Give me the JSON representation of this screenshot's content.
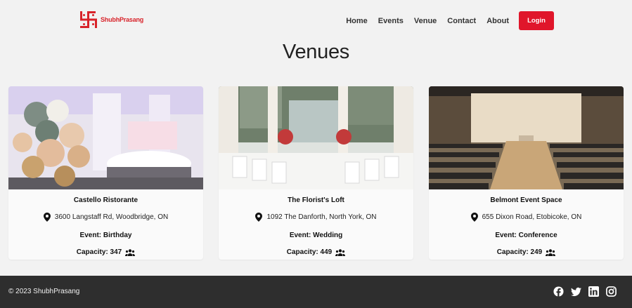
{
  "brand": {
    "name": "ShubhPrasang",
    "color": "#d8232a"
  },
  "nav": {
    "items": [
      {
        "label": "Home"
      },
      {
        "label": "Events"
      },
      {
        "label": "Venue"
      },
      {
        "label": "Contact"
      },
      {
        "label": "About"
      }
    ],
    "login_label": "Login"
  },
  "page": {
    "title": "Venues"
  },
  "venues": [
    {
      "name": "Castello Ristorante",
      "address": "3600 Langstaff Rd, Woodbridge, ON",
      "event": "Event: Birthday",
      "capacity": "Capacity: 347"
    },
    {
      "name": "The Florist's Loft",
      "address": "1092 The Danforth, North York, ON",
      "event": "Event: Wedding",
      "capacity": "Capacity: 449"
    },
    {
      "name": "Belmont Event Space",
      "address": "655 Dixon Road, Etobicoke, ON",
      "event": "Event: Conference",
      "capacity": "Capacity: 249"
    }
  ],
  "footer": {
    "copyright": "© 2023 ShubhPrasang",
    "socials": [
      "facebook-icon",
      "twitter-icon",
      "linkedin-icon",
      "instagram-icon"
    ]
  },
  "colors": {
    "accent": "#e0162b",
    "footer_bg": "#2e2e2e",
    "page_bg": "#f2f2f2"
  }
}
